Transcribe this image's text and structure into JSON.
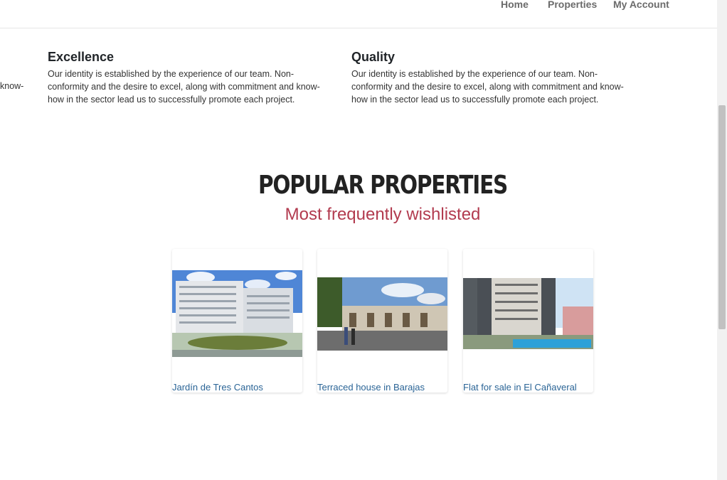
{
  "nav": {
    "home": "Home",
    "properties": "Properties",
    "account": "My Account"
  },
  "features": [
    {
      "title": "Excellence",
      "text": "Our identity is established by the experience of our team. Non-conformity and the desire to excel, along with commitment and know-how in the sector lead us to successfully promote each project."
    },
    {
      "title": "Quality",
      "text": "Our identity is established by the experience of our team. Non-conformity and the desire to excel, along with commitment and know-how in the sector lead us to successfully promote each project."
    }
  ],
  "left_cut_text": "know-",
  "popular": {
    "title": "POPULAR PROPERTIES",
    "subtitle": "Most frequently wishlisted",
    "subtitle_color": "#b23b4f",
    "cards": [
      {
        "title": "Jardín de Tres Cantos"
      },
      {
        "title": "Terraced house in Barajas"
      },
      {
        "title": "Flat for sale in El Cañaveral"
      }
    ]
  }
}
